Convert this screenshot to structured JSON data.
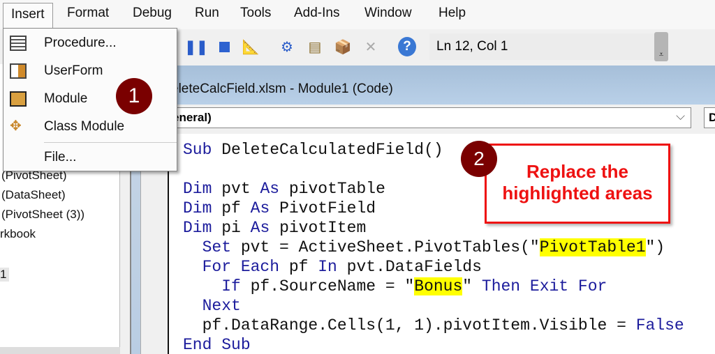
{
  "menubar": {
    "items": [
      "Insert",
      "Format",
      "Debug",
      "Run",
      "Tools",
      "Add-Ins",
      "Window",
      "Help"
    ]
  },
  "insert_menu": {
    "items": [
      {
        "label": "Procedure...",
        "icon": "procedure-icon"
      },
      {
        "label": "UserForm",
        "icon": "userform-icon"
      },
      {
        "label": "Module",
        "icon": "module-icon"
      },
      {
        "label": "Class Module",
        "icon": "class-module-icon"
      },
      {
        "label": "File...",
        "icon": ""
      }
    ]
  },
  "toolbar": {
    "status": "Ln 12, Col 1",
    "grip": "⩡"
  },
  "project": {
    "items": [
      "(PivotSheet)",
      "(DataSheet)",
      "(PivotSheet (3))",
      "rkbook",
      "1"
    ]
  },
  "codewindow": {
    "title": "eleteCalcField.xlsm - Module1 (Code)",
    "object_combo": "eneral)",
    "proc_combo": "D",
    "chevron": "⌵"
  },
  "code": [
    [
      {
        "t": "Sub ",
        "k": "kw"
      },
      {
        "t": "DeleteCalculatedField()",
        "k": ""
      }
    ],
    [],
    [
      {
        "t": "Dim ",
        "k": "kw"
      },
      {
        "t": "pvt ",
        "k": ""
      },
      {
        "t": "As ",
        "k": "kw"
      },
      {
        "t": "pivotTable",
        "k": ""
      }
    ],
    [
      {
        "t": "Dim ",
        "k": "kw"
      },
      {
        "t": "pf ",
        "k": ""
      },
      {
        "t": "As ",
        "k": "kw"
      },
      {
        "t": "PivotField",
        "k": ""
      }
    ],
    [
      {
        "t": "Dim ",
        "k": "kw"
      },
      {
        "t": "pi ",
        "k": ""
      },
      {
        "t": "As ",
        "k": "kw"
      },
      {
        "t": "pivotItem",
        "k": ""
      }
    ],
    [
      {
        "t": "  Set ",
        "k": "kw"
      },
      {
        "t": "pvt = ActiveSheet.PivotTables(\"",
        "k": ""
      },
      {
        "t": "PivotTable1",
        "k": "hl"
      },
      {
        "t": "\")",
        "k": ""
      }
    ],
    [
      {
        "t": "  For Each ",
        "k": "kw"
      },
      {
        "t": "pf ",
        "k": ""
      },
      {
        "t": "In ",
        "k": "kw"
      },
      {
        "t": "pvt.DataFields",
        "k": ""
      }
    ],
    [
      {
        "t": "    If ",
        "k": "kw"
      },
      {
        "t": "pf.SourceName = \"",
        "k": ""
      },
      {
        "t": "Bonus",
        "k": "hl"
      },
      {
        "t": "\" ",
        "k": ""
      },
      {
        "t": "Then Exit For",
        "k": "kw"
      }
    ],
    [
      {
        "t": "  Next",
        "k": "kw"
      }
    ],
    [
      {
        "t": "  pf.DataRange.Cells(1, 1).pivotItem.Visible = ",
        "k": ""
      },
      {
        "t": "False",
        "k": "kw"
      }
    ],
    [
      {
        "t": "End Sub",
        "k": "kw"
      }
    ]
  ],
  "annotations": {
    "badge1": "1",
    "badge2": "2",
    "callout_line1": "Replace the",
    "callout_line2": "highlighted areas"
  }
}
